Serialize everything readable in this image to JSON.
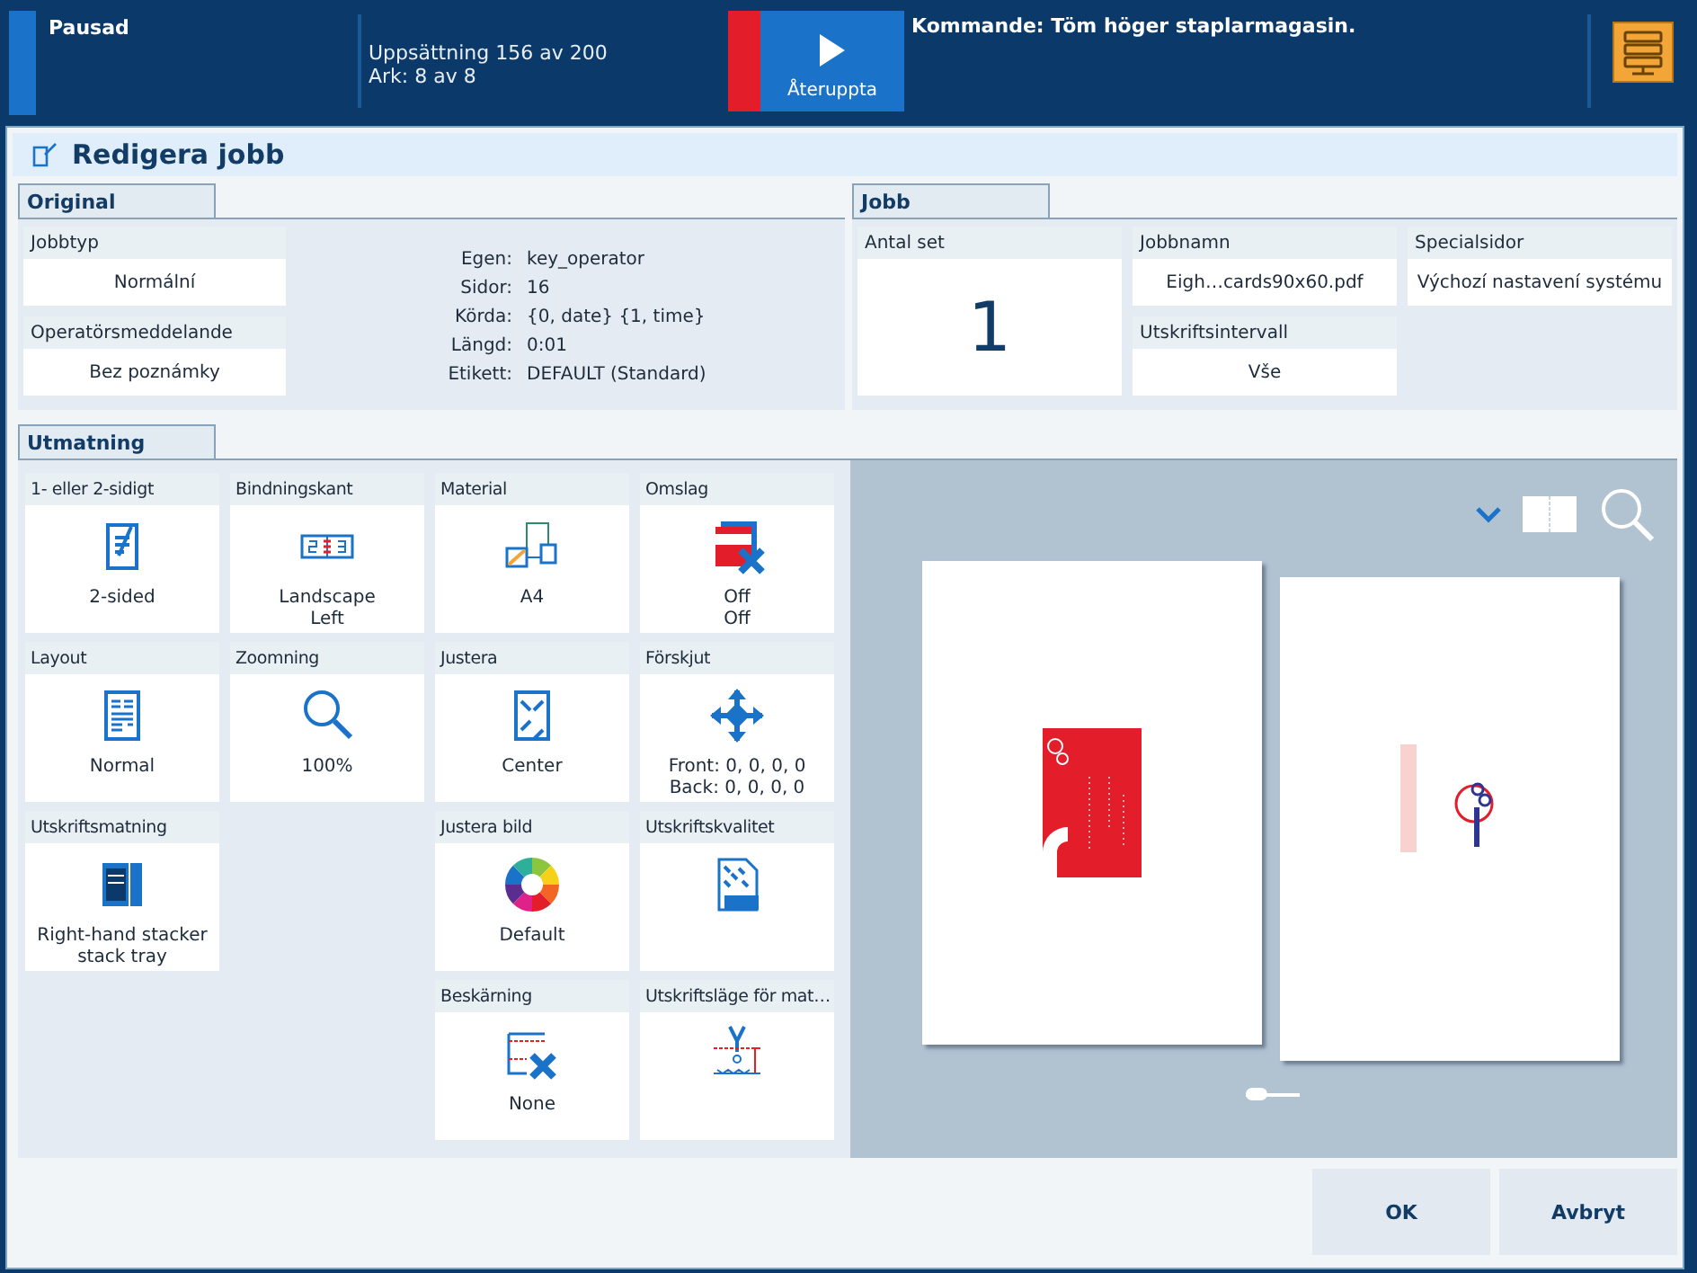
{
  "status_bar": {
    "state": "Pausad",
    "progress": [
      "Uppsättning 156 av 200",
      "Ark: 8 av 8"
    ],
    "resume_button": "Återuppta",
    "next_command": "Kommande: Töm höger staplarmagasin."
  },
  "dialog": {
    "title": "Redigera jobb"
  },
  "original": {
    "tab": "Original",
    "fields": [
      {
        "label": "Jobbtyp",
        "value": "Normální"
      },
      {
        "label": "Operatörsmeddelande",
        "value": "Bez poznámky"
      }
    ],
    "info": [
      {
        "key": "Egen:",
        "value": "key_operator"
      },
      {
        "key": "Sidor:",
        "value": "16"
      },
      {
        "key": "Körda:",
        "value": "{0, date} {1, time}"
      },
      {
        "key": "Längd:",
        "value": "0:01"
      },
      {
        "key": "Etikett:",
        "value": "DEFAULT (Standard)"
      }
    ]
  },
  "job": {
    "tab": "Jobb",
    "copies": {
      "label": "Antal set",
      "value": "1"
    },
    "fields": [
      {
        "label": "Jobbnamn",
        "value": "Eigh…cards90x60.pdf"
      },
      {
        "label": "Specialsidor",
        "value": "Výchozí nastavení systému"
      },
      {
        "label": "Utskriftsintervall",
        "value": "Vše"
      }
    ]
  },
  "output": {
    "tab": "Utmatning",
    "rows": [
      [
        {
          "kind": "duplex",
          "label": "1- eller 2-sidigt",
          "values": [
            "2-sided"
          ]
        },
        {
          "kind": "binding",
          "label": "Bindningskant",
          "values": [
            "Landscape",
            "Left"
          ]
        },
        {
          "kind": "media",
          "label": "Material",
          "values": [
            "A4"
          ]
        },
        {
          "kind": "cover",
          "label": "Omslag",
          "values": [
            "Off",
            "Off"
          ]
        }
      ],
      [
        {
          "kind": "layout",
          "label": "Layout",
          "values": [
            "Normal"
          ]
        },
        {
          "kind": "zoom",
          "label": "Zoomning",
          "values": [
            "100%"
          ]
        },
        {
          "kind": "align",
          "label": "Justera",
          "values": [
            "Center"
          ]
        },
        {
          "kind": "shift",
          "label": "Förskjut",
          "values": [
            "Front: 0, 0, 0, 0",
            "Back: 0, 0, 0, 0"
          ]
        }
      ],
      [
        {
          "kind": "tray",
          "label": "Utskriftsmatning",
          "values": [
            "Right-hand stacker",
            "stack tray"
          ]
        },
        {
          "kind": "blank"
        },
        {
          "kind": "color",
          "label": "Justera bild",
          "values": [
            "Default"
          ]
        },
        {
          "kind": "quality",
          "label": "Utskriftskvalitet"
        }
      ],
      [
        {
          "kind": "blank"
        },
        {
          "kind": "blank"
        },
        {
          "kind": "trim",
          "label": "Beskärning",
          "values": [
            "None"
          ]
        },
        {
          "kind": "mode",
          "label": "Utskriftsläge för mat…"
        }
      ]
    ]
  },
  "preview": {
    "slider": {
      "level": 0
    }
  },
  "buttons": [
    "OK",
    "Avbryt"
  ]
}
